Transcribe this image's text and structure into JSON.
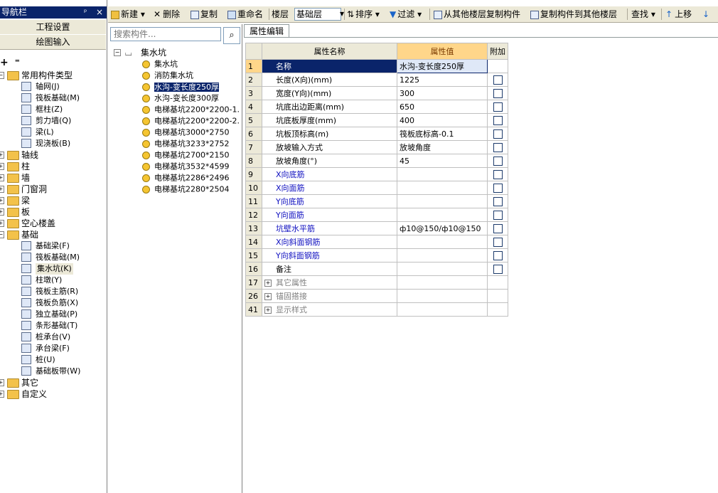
{
  "nav": {
    "title": "导航栏",
    "pin": "ᵖ",
    "close": "×",
    "buttons": [
      "工程设置",
      "绘图输入"
    ],
    "tools": [
      "+",
      "⁼"
    ],
    "tree": [
      {
        "level": 0,
        "label": "常用构件类型",
        "expanded": true
      },
      {
        "level": 1,
        "label": "轴网(J)"
      },
      {
        "level": 1,
        "label": "筏板基础(M)"
      },
      {
        "level": 1,
        "label": "框柱(Z)"
      },
      {
        "level": 1,
        "label": "剪力墙(Q)"
      },
      {
        "level": 1,
        "label": "梁(L)"
      },
      {
        "level": 1,
        "label": "现浇板(B)"
      },
      {
        "level": 0,
        "label": "轴线",
        "expanded": false
      },
      {
        "level": 0,
        "label": "柱",
        "expanded": false
      },
      {
        "level": 0,
        "label": "墙",
        "expanded": false
      },
      {
        "level": 0,
        "label": "门窗洞",
        "expanded": false
      },
      {
        "level": 0,
        "label": "梁",
        "expanded": false
      },
      {
        "level": 0,
        "label": "板",
        "expanded": false
      },
      {
        "level": 0,
        "label": "空心楼盖",
        "expanded": false
      },
      {
        "level": 0,
        "label": "基础",
        "expanded": true
      },
      {
        "level": 1,
        "label": "基础梁(F)"
      },
      {
        "level": 1,
        "label": "筏板基础(M)"
      },
      {
        "level": 1,
        "label": "集水坑(K)",
        "selected": true
      },
      {
        "level": 1,
        "label": "柱墩(Y)"
      },
      {
        "level": 1,
        "label": "筏板主筋(R)"
      },
      {
        "level": 1,
        "label": "筏板负筋(X)"
      },
      {
        "level": 1,
        "label": "独立基础(P)"
      },
      {
        "level": 1,
        "label": "条形基础(T)"
      },
      {
        "level": 1,
        "label": "桩承台(V)"
      },
      {
        "level": 1,
        "label": "承台梁(F)"
      },
      {
        "level": 1,
        "label": "桩(U)"
      },
      {
        "level": 1,
        "label": "基础板带(W)"
      },
      {
        "level": 0,
        "label": "其它",
        "expanded": false
      },
      {
        "level": 0,
        "label": "自定义",
        "expanded": false
      }
    ]
  },
  "toolbar": {
    "new": "新建",
    "delete": "删除",
    "copy": "复制",
    "rename": "重命名",
    "floor_label": "楼层",
    "floor_value": "基础层",
    "sort": "排序",
    "filter": "过滤",
    "copy_from_floor": "从其他楼层复制构件",
    "copy_to_floor": "复制构件到其他楼层",
    "find": "查找",
    "move_up": "上移",
    "move_down_arrow": "↓"
  },
  "search": {
    "placeholder": "搜索构件..."
  },
  "component_tree": {
    "root": "集水坑",
    "items": [
      "集水坑",
      "消防集水坑",
      "水沟-变长度250厚",
      "水沟-变长度300厚",
      "电梯基坑2200*2200-1.",
      "电梯基坑2200*2200-2.",
      "电梯基坑3000*2750",
      "电梯基坑3233*2752",
      "电梯基坑2700*2150",
      "电梯基坑3532*4599",
      "电梯基坑2286*2496",
      "电梯基坑2280*2504"
    ],
    "selected_index": 2
  },
  "properties": {
    "tab": "属性编辑",
    "headers": [
      "属性名称",
      "属性值",
      "附加"
    ],
    "rows": [
      {
        "n": "1",
        "name": "名称",
        "value": "水沟-变长度250厚",
        "style": "name",
        "check": false
      },
      {
        "n": "2",
        "name": "长度(X向)(mm)",
        "value": "1225",
        "style": "",
        "check": true
      },
      {
        "n": "3",
        "name": "宽度(Y向)(mm)",
        "value": "300",
        "style": "",
        "check": true
      },
      {
        "n": "4",
        "name": "坑底出边距离(mm)",
        "value": "650",
        "style": "",
        "check": true
      },
      {
        "n": "5",
        "name": "坑底板厚度(mm)",
        "value": "400",
        "style": "",
        "check": true
      },
      {
        "n": "6",
        "name": "坑板顶标高(m)",
        "value": "筏板底标高-0.1",
        "style": "",
        "check": true
      },
      {
        "n": "7",
        "name": "放坡输入方式",
        "value": "放坡角度",
        "style": "",
        "check": true
      },
      {
        "n": "8",
        "name": "放坡角度(°)",
        "value": "45",
        "style": "",
        "check": true
      },
      {
        "n": "9",
        "name": "X向底筋",
        "value": "",
        "style": "blue",
        "check": true
      },
      {
        "n": "10",
        "name": "X向面筋",
        "value": "",
        "style": "blue",
        "check": true
      },
      {
        "n": "11",
        "name": "Y向底筋",
        "value": "",
        "style": "blue",
        "check": true
      },
      {
        "n": "12",
        "name": "Y向面筋",
        "value": "",
        "style": "blue",
        "check": true
      },
      {
        "n": "13",
        "name": "坑壁水平筋",
        "value": "ф10@150/ф10@150",
        "style": "blue",
        "check": true
      },
      {
        "n": "14",
        "name": "X向斜面钢筋",
        "value": "",
        "style": "blue",
        "check": true
      },
      {
        "n": "15",
        "name": "Y向斜面钢筋",
        "value": "",
        "style": "blue",
        "check": true
      },
      {
        "n": "16",
        "name": "备注",
        "value": "",
        "style": "",
        "check": true
      },
      {
        "n": "17",
        "name": "其它属性",
        "value": "",
        "style": "group",
        "check": false
      },
      {
        "n": "26",
        "name": "锚固搭接",
        "value": "",
        "style": "group",
        "check": false
      },
      {
        "n": "41",
        "name": "显示样式",
        "value": "",
        "style": "group",
        "check": false
      }
    ]
  }
}
